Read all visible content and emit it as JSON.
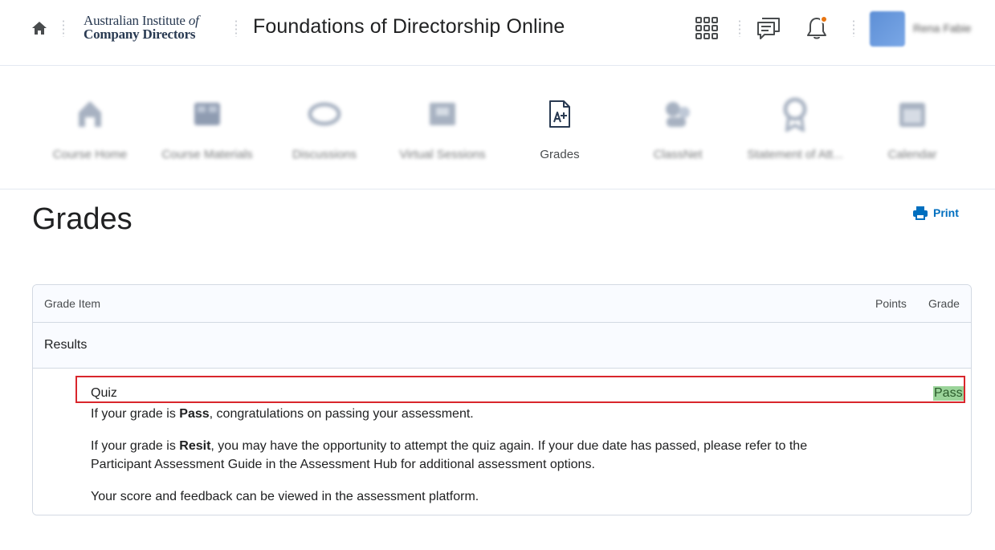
{
  "header": {
    "home_icon": "home-icon",
    "logo_line1": "Australian Institute",
    "logo_of": "of",
    "logo_line2": "Company Directors",
    "course_title": "Foundations of Directorship Online",
    "icons": [
      "app-grid-icon",
      "message-alert-icon",
      "notification-bell-icon"
    ],
    "notification_dot_color": "#e87511",
    "user_name": "Rena Fabie"
  },
  "nav": {
    "items": [
      {
        "label": "Course Home",
        "icon": "home-icon"
      },
      {
        "label": "Course Materials",
        "icon": "book-icon"
      },
      {
        "label": "Discussions",
        "icon": "discussion-icon"
      },
      {
        "label": "Virtual Sessions",
        "icon": "video-icon"
      },
      {
        "label": "Grades",
        "icon": "grade-file-icon",
        "active": true
      },
      {
        "label": "ClassNet",
        "icon": "people-icon"
      },
      {
        "label": "Statement of Att...",
        "icon": "award-ribbon-icon"
      },
      {
        "label": "Calendar",
        "icon": "calendar-icon"
      }
    ]
  },
  "page": {
    "title": "Grades",
    "print_label": "Print"
  },
  "table": {
    "headers": {
      "item": "Grade Item",
      "points": "Points",
      "grade": "Grade"
    },
    "category": "Results",
    "item": {
      "name": "Quiz",
      "grade": "Pass",
      "grade_highlight_color": "#9bd49a"
    },
    "feedback": {
      "p1_pre": "If your grade is ",
      "p1_bold": "Pass",
      "p1_post": ", congratulations on passing your assessment.",
      "p2_pre": "If your grade is ",
      "p2_bold": "Resit",
      "p2_post": ", you may have the opportunity to attempt the quiz again. If your due date has passed, please refer to the Participant Assessment Guide in the Assessment Hub for additional assessment options.",
      "p3": "Your score and feedback can be viewed in the assessment platform."
    }
  },
  "colors": {
    "link": "#006fbf",
    "highlight_border": "#d9262c",
    "brand_navy": "#293a52"
  }
}
